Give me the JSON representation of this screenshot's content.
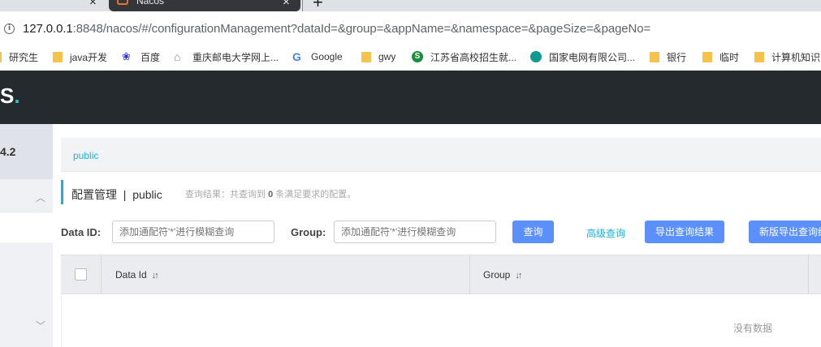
{
  "browser": {
    "tab_title": "Nacos",
    "url_host": "127.0.0.1",
    "url_rest": ":8848/nacos/#/configurationManagement?dataId=&group=&appName=&namespace=&pageSize=&pageNo=",
    "bookmarks": [
      {
        "label": "研究生",
        "icon": "folder"
      },
      {
        "label": "java开发",
        "icon": "folder"
      },
      {
        "label": "百度",
        "icon": "baidu-paw"
      },
      {
        "label": "重庆邮电大学网上...",
        "icon": "house"
      },
      {
        "label": "Google",
        "icon": "google-g"
      },
      {
        "label": "gwy",
        "icon": "folder"
      },
      {
        "label": "江苏省高校招生就...",
        "icon": "s-logo"
      },
      {
        "label": "国家电网有限公司...",
        "icon": "globe"
      },
      {
        "label": "银行",
        "icon": "folder"
      },
      {
        "label": "临时",
        "icon": "folder"
      },
      {
        "label": "计算机知识",
        "icon": "folder"
      }
    ]
  },
  "header": {
    "logo_tail": "S",
    "logo_dot": "."
  },
  "sidebar": {
    "version": "4.2"
  },
  "breadcrumb": {
    "namespace": "public"
  },
  "page": {
    "title": "配置管理",
    "separator": "|",
    "namespace": "public",
    "result_prefix": "查询结果：共查询到",
    "result_count": "0",
    "result_suffix": "条满足要求的配置。"
  },
  "search": {
    "dataid_label": "Data ID:",
    "dataid_placeholder": "添加通配符'*'进行模糊查询",
    "group_label": "Group:",
    "group_placeholder": "添加通配符'*'进行模糊查询",
    "query_button": "查询",
    "advanced_link": "高级查询",
    "export_button": "导出查询结果",
    "new_export_button": "新版导出查询结"
  },
  "table": {
    "columns": [
      "Data Id",
      "Group"
    ],
    "empty_text": "没有数据"
  },
  "colors": {
    "header_bg": "#252a2f",
    "accent": "#1ab3d6",
    "primary_button": "#5b8ff9"
  }
}
